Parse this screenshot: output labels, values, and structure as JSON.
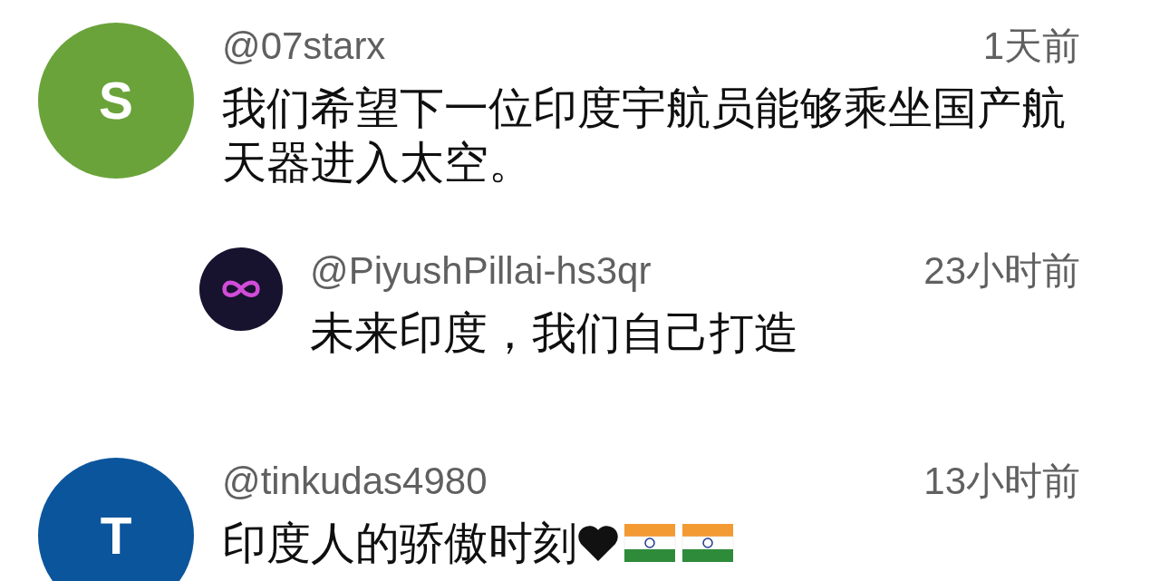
{
  "comments": [
    {
      "author": "@07starx",
      "time": "1天前",
      "text": "我们希望下一位印度宇航员能够乘坐国产航天器进入太空。",
      "avatar": {
        "kind": "letter",
        "letter": "S",
        "color": "#6aa33a"
      },
      "replies": [
        {
          "author": "@PiyushPillai-hs3qr",
          "time": "23小时前",
          "text": "未来印度，我们自己打造",
          "avatar": {
            "kind": "logo"
          }
        }
      ]
    },
    {
      "author": "@tinkudas4980",
      "time": "13小时前",
      "text": "印度人的骄傲时刻",
      "avatar": {
        "kind": "letter",
        "letter": "T",
        "color": "#0b559c"
      },
      "decorations": [
        {
          "kind": "heart"
        },
        {
          "kind": "flag"
        },
        {
          "kind": "flag"
        }
      ]
    }
  ]
}
